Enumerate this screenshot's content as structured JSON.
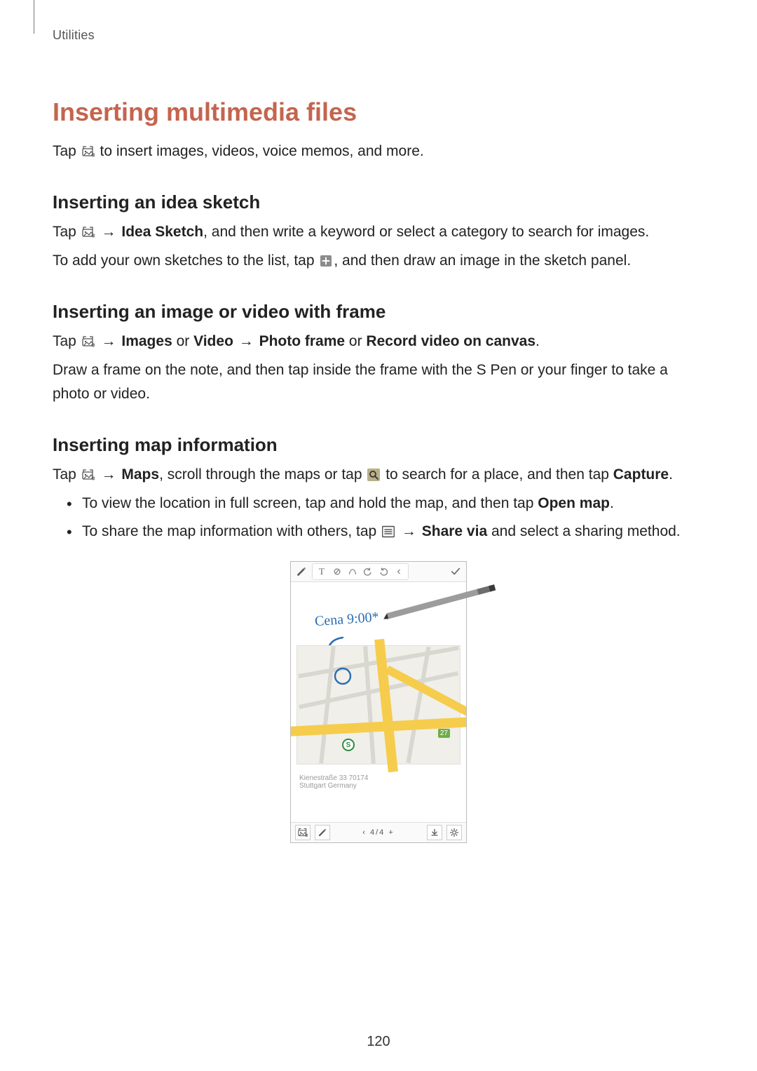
{
  "running_head": "Utilities",
  "h1": "Inserting multimedia files",
  "intro": {
    "pre": "Tap ",
    "post": " to insert images, videos, voice memos, and more."
  },
  "sec1": {
    "heading": "Inserting an idea sketch",
    "line1": {
      "pre": "Tap ",
      "arrow": " → ",
      "bold": "Idea Sketch",
      "post": ", and then write a keyword or select a category to search for images."
    },
    "line2": {
      "pre": "To add your own sketches to the list, tap ",
      "post": ", and then draw an image in the sketch panel."
    }
  },
  "sec2": {
    "heading": "Inserting an image or video with frame",
    "line1": {
      "pre": "Tap ",
      "arrow1": " → ",
      "b1": "Images",
      "or1": " or ",
      "b2": "Video",
      "arrow2": " → ",
      "b3": "Photo frame",
      "or2": " or ",
      "b4": "Record video on canvas",
      "period": "."
    },
    "line2": "Draw a frame on the note, and then tap inside the frame with the S Pen or your finger to take a photo or video."
  },
  "sec3": {
    "heading": "Inserting map information",
    "line1": {
      "pre": "Tap ",
      "arrow": " → ",
      "b1": "Maps",
      "mid": ", scroll through the maps or tap ",
      "mid2": " to search for a place, and then tap ",
      "b2": "Capture",
      "period": "."
    },
    "bullets": [
      {
        "pre": "To view the location in full screen, tap and hold the map, and then tap ",
        "b": "Open map",
        "post": "."
      },
      {
        "pre": "To share the map information with others, tap ",
        "arrow": " → ",
        "b": "Share via",
        "post": " and select a sharing method."
      }
    ]
  },
  "screenshot": {
    "handwriting": "Cena 9:00*",
    "caption_line1": "Kienestraße 33 70174",
    "caption_line2": "Stuttgart Germany",
    "pager": "‹   4/4   +",
    "badge": "27",
    "s_label": "S"
  },
  "page_number": "120"
}
